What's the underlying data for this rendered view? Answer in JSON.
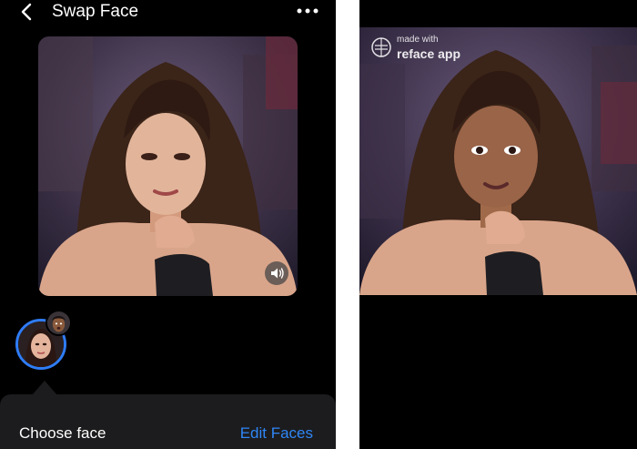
{
  "header": {
    "title": "Swap Face",
    "back_icon": "chevron-left-icon",
    "more_icon": "more-horizontal-icon"
  },
  "video": {
    "sound_icon": "speaker-icon"
  },
  "faces": {
    "selected_icon": "face-thumbnail",
    "extra_icon": "face-thumbnail",
    "accent": "#2f7cf6"
  },
  "bottom_sheet": {
    "choose_label": "Choose face",
    "edit_label": "Edit Faces",
    "edit_color": "#2f86f6",
    "background": "#1c1c1e"
  },
  "watermark": {
    "line1": "made with",
    "line2": "reface app"
  }
}
